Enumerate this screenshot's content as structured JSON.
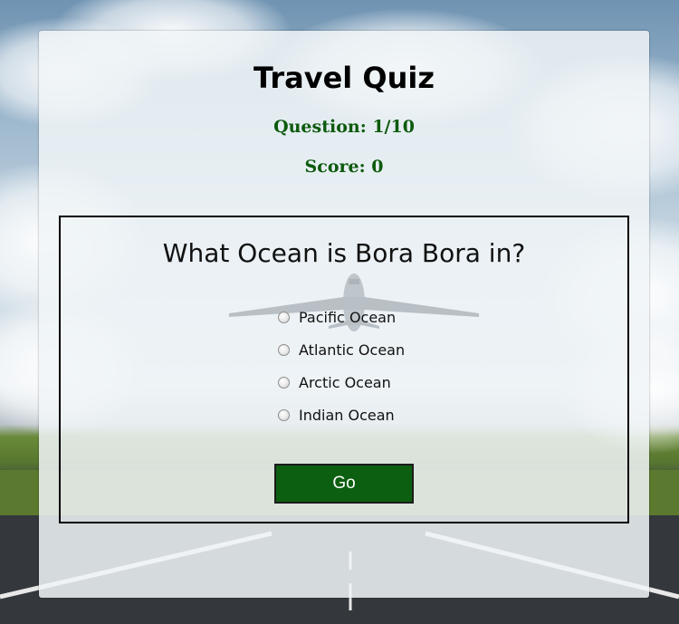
{
  "quiz": {
    "title": "Travel Quiz",
    "question_counter": "Question: 1/10",
    "score": "Score: 0",
    "question": "What Ocean is Bora Bora in?",
    "options": [
      {
        "label": "Pacific Ocean",
        "selected": false
      },
      {
        "label": "Atlantic Ocean",
        "selected": false
      },
      {
        "label": "Arctic Ocean",
        "selected": false
      },
      {
        "label": "Indian Ocean",
        "selected": false
      }
    ],
    "submit_label": "Go"
  },
  "colors": {
    "accent_green": "#0c5e10",
    "stat_text_green": "#0c5a0c",
    "panel_background": "#f0f4f7"
  },
  "background": {
    "scene": "airplane-on-runway-sky-photo"
  }
}
